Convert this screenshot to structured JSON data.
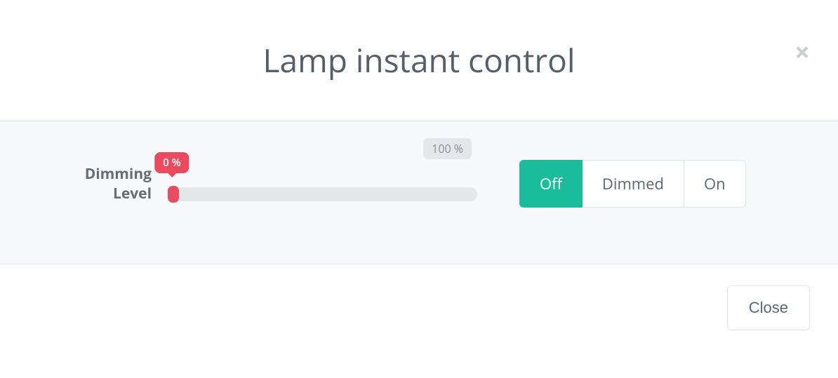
{
  "modal": {
    "title": "Lamp instant control",
    "close_icon_glyph": "×"
  },
  "dimming": {
    "label_line1": "Dimming",
    "label_line2": "Level",
    "current_tooltip": "0 %",
    "max_label": "100 %"
  },
  "modes": {
    "off": "Off",
    "dimmed": "Dimmed",
    "on": "On"
  },
  "footer": {
    "close_label": "Close"
  }
}
